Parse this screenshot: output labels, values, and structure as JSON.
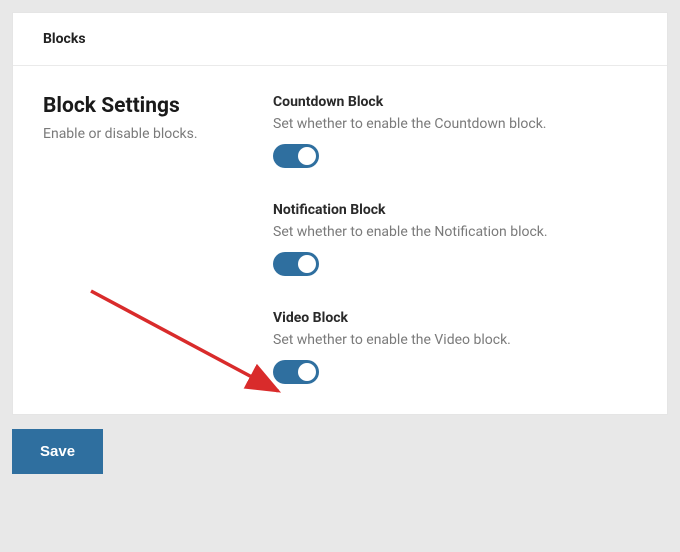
{
  "header": {
    "title": "Blocks"
  },
  "section": {
    "heading": "Block Settings",
    "subtitle": "Enable or disable blocks."
  },
  "settings": {
    "countdown": {
      "title": "Countdown Block",
      "desc": "Set whether to enable the Countdown block."
    },
    "notification": {
      "title": "Notification Block",
      "desc": "Set whether to enable the Notification block."
    },
    "video": {
      "title": "Video Block",
      "desc": "Set whether to enable the Video block."
    }
  },
  "actions": {
    "save": "Save"
  }
}
